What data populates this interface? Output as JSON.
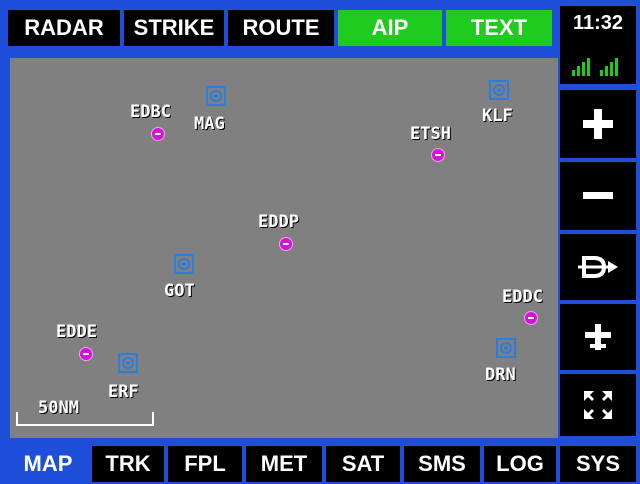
{
  "top_tabs": [
    {
      "label": "RADAR"
    },
    {
      "label": "STRIKE"
    },
    {
      "label": "ROUTE"
    },
    {
      "label": "AIP"
    },
    {
      "label": "TEXT"
    }
  ],
  "status": {
    "time": "11:32",
    "signal_bars": 2
  },
  "side_buttons": [
    {
      "icon": "zoom-in-icon"
    },
    {
      "icon": "zoom-out-icon"
    },
    {
      "icon": "direct-to-icon"
    },
    {
      "icon": "aircraft-icon"
    },
    {
      "icon": "fullscreen-icon"
    }
  ],
  "bottom_tabs": [
    {
      "label": "MAP"
    },
    {
      "label": "TRK"
    },
    {
      "label": "FPL"
    },
    {
      "label": "MET"
    },
    {
      "label": "SAT"
    },
    {
      "label": "SMS"
    },
    {
      "label": "LOG"
    },
    {
      "label": "SYS"
    }
  ],
  "map": {
    "airports": [
      {
        "code": "EDBC"
      },
      {
        "code": "ETSH"
      },
      {
        "code": "EDDP"
      },
      {
        "code": "EDDC"
      },
      {
        "code": "EDDE"
      }
    ],
    "navaids": [
      {
        "code": "MAG"
      },
      {
        "code": "KLF"
      },
      {
        "code": "GOT"
      },
      {
        "code": "DRN"
      },
      {
        "code": "ERF"
      }
    ],
    "scale_label": "50NM"
  },
  "colors": {
    "frame": "#1f4fd8",
    "active_tab": "#1ecb1e",
    "map_bg": "#808080",
    "airport": "#d415d4",
    "navaid": "#2a7de0"
  }
}
